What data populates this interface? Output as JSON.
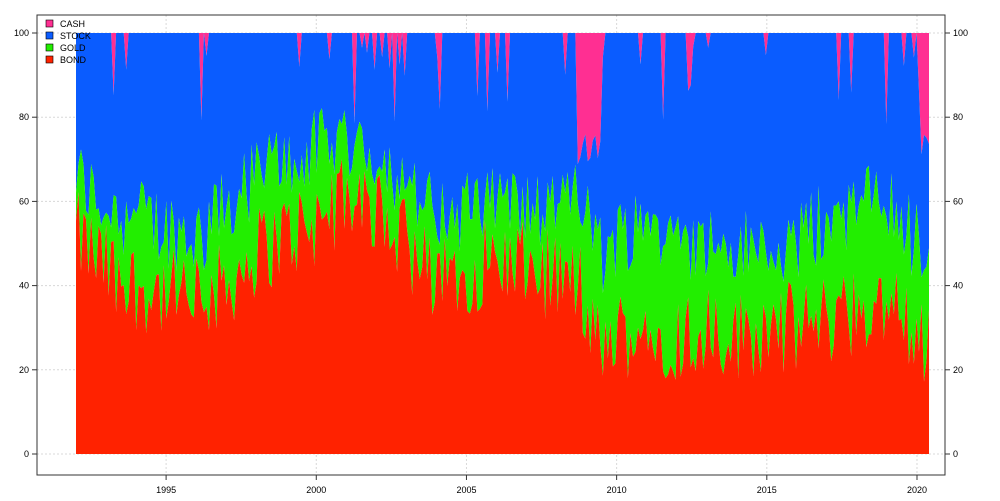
{
  "chart_data": {
    "type": "area",
    "stacked": true,
    "stacked_to_percent": true,
    "x_start": 1992.0,
    "x_end": 2020.4,
    "xlim": [
      1992.0,
      2020.4
    ],
    "ylim": [
      0,
      100
    ],
    "x_ticks": [
      1995,
      2000,
      2005,
      2010,
      2015,
      2020
    ],
    "x_tick_labels": [
      "1995",
      "2000",
      "2005",
      "2010",
      "2015",
      "2020"
    ],
    "y_ticks": [
      0,
      20,
      40,
      60,
      80,
      100
    ],
    "y_tick_labels": [
      "0",
      "20",
      "40",
      "60",
      "80",
      "100"
    ],
    "y_axis_sides": [
      "left",
      "right"
    ],
    "grid": true,
    "legend_position": "top-left",
    "series_order_bottom_to_top": [
      "BOND",
      "GOLD",
      "STOCK",
      "CASH"
    ],
    "legend": [
      {
        "name": "CASH",
        "color": "#ff2f92"
      },
      {
        "name": "STOCK",
        "color": "#0a5cff"
      },
      {
        "name": "GOLD",
        "color": "#22ee00"
      },
      {
        "name": "BOND",
        "color": "#ff2200"
      }
    ],
    "anchors": {
      "x": [
        1992.0,
        1993.0,
        1994.0,
        1995.0,
        1996.0,
        1997.0,
        1998.0,
        1999.0,
        2000.0,
        2001.0,
        2002.0,
        2003.0,
        2004.0,
        2005.0,
        2006.0,
        2007.0,
        2008.0,
        2008.8,
        2009.5,
        2010.0,
        2011.0,
        2012.0,
        2013.0,
        2014.0,
        2015.0,
        2016.0,
        2017.0,
        2018.0,
        2019.0,
        2020.0,
        2020.4
      ],
      "bond_top": [
        52,
        44,
        40,
        38,
        36,
        40,
        48,
        52,
        55,
        62,
        58,
        50,
        40,
        44,
        46,
        44,
        42,
        40,
        24,
        28,
        30,
        28,
        30,
        28,
        30,
        30,
        32,
        34,
        36,
        30,
        24
      ],
      "gold_top": [
        66,
        58,
        56,
        54,
        52,
        58,
        66,
        70,
        72,
        76,
        70,
        64,
        56,
        58,
        60,
        58,
        56,
        60,
        46,
        52,
        56,
        52,
        50,
        48,
        50,
        50,
        56,
        58,
        62,
        50,
        40
      ],
      "stock_top": [
        100,
        100,
        100,
        100,
        100,
        100,
        100,
        100,
        100,
        100,
        100,
        100,
        100,
        100,
        100,
        100,
        100,
        100,
        100,
        100,
        100,
        100,
        100,
        100,
        100,
        100,
        100,
        100,
        100,
        100,
        100
      ],
      "cash_fraction": [
        0.0,
        0.06,
        0.03,
        0.05,
        0.06,
        0.08,
        0.05,
        0.04,
        0.07,
        0.06,
        0.08,
        0.07,
        0.05,
        0.04,
        0.05,
        0.06,
        0.07,
        0.3,
        0.12,
        0.05,
        0.03,
        0.04,
        0.06,
        0.05,
        0.03,
        0.02,
        0.03,
        0.04,
        0.05,
        0.08,
        0.3
      ]
    },
    "cash_spike_periods": [
      [
        2008.7,
        2009.5
      ],
      [
        2020.1,
        2020.4
      ]
    ]
  }
}
